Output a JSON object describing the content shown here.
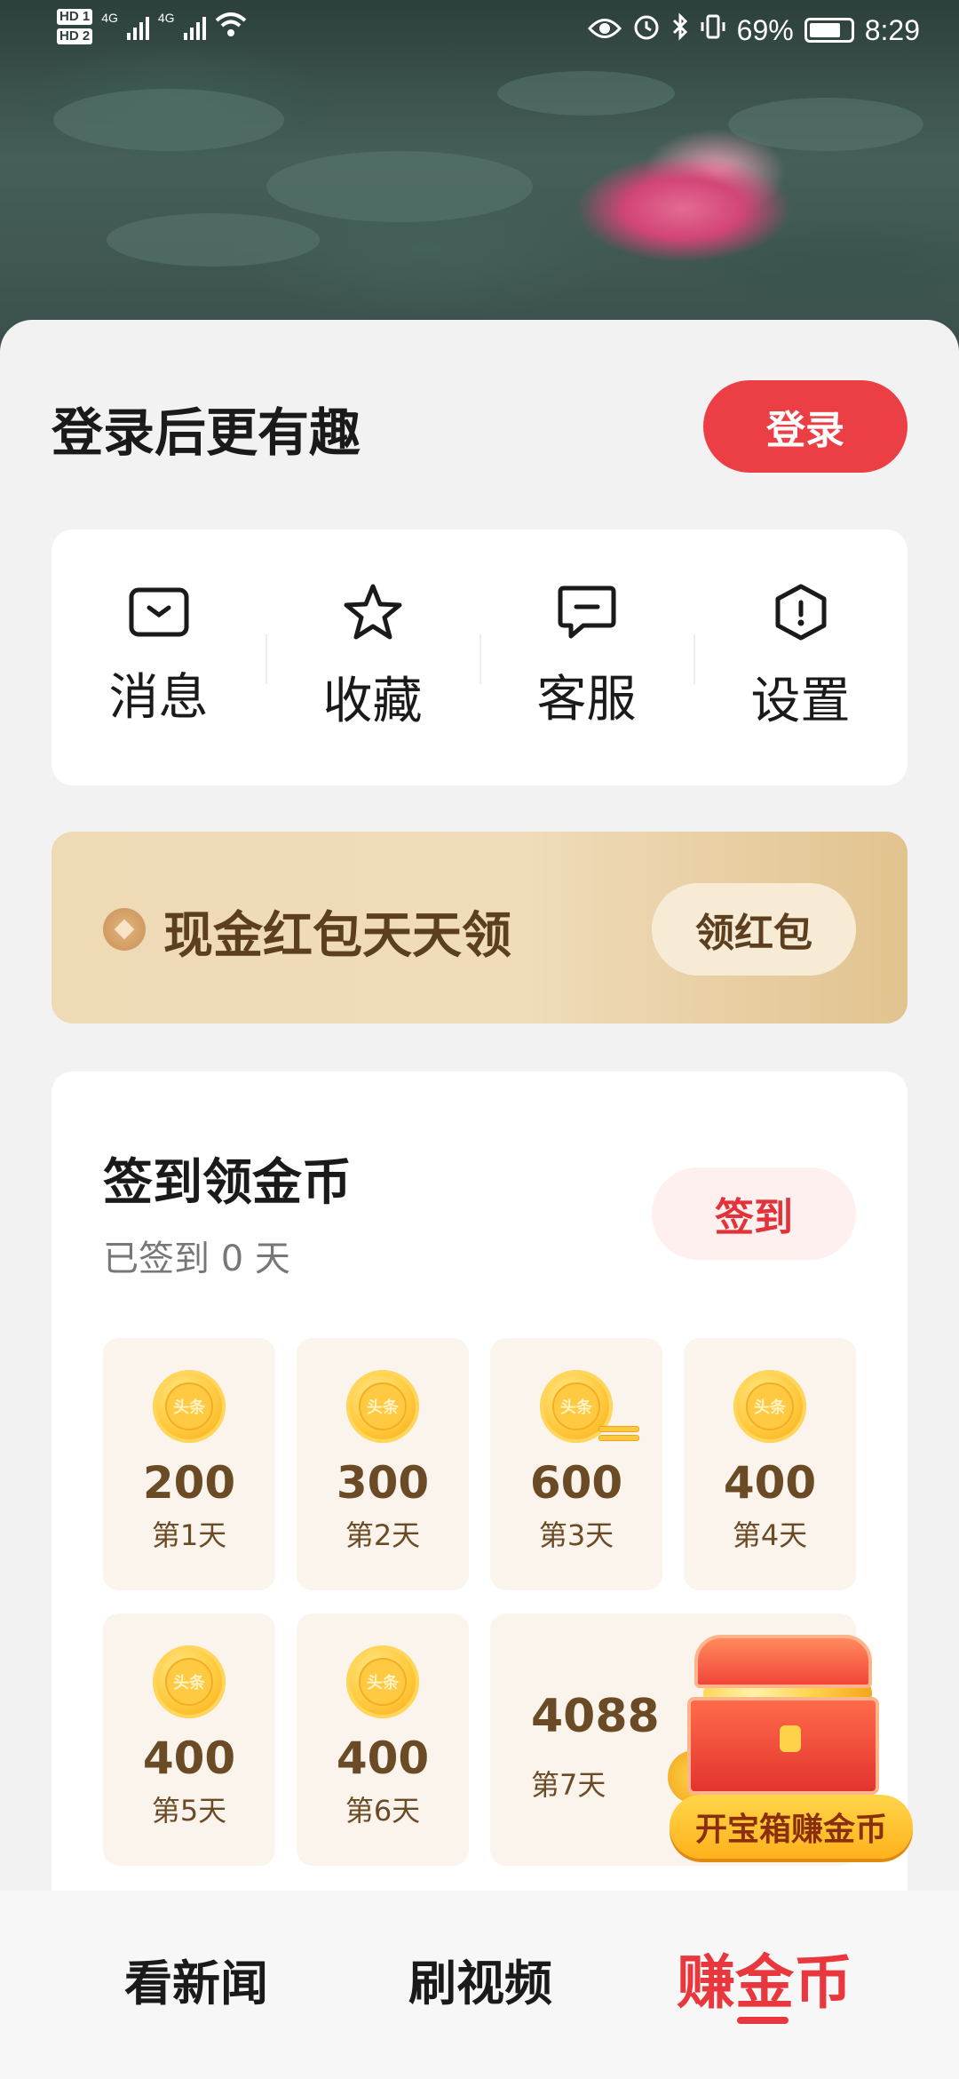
{
  "status_bar": {
    "hd1": "HD 1",
    "hd2": "HD 2",
    "net1": "4G",
    "net2": "4G",
    "battery": "69%",
    "time": "8:29"
  },
  "login": {
    "title": "登录后更有趣",
    "button": "登录"
  },
  "menu": {
    "items": [
      {
        "label": "消息",
        "icon": "message-icon"
      },
      {
        "label": "收藏",
        "icon": "star-icon"
      },
      {
        "label": "客服",
        "icon": "customer-service-icon"
      },
      {
        "label": "设置",
        "icon": "settings-icon"
      }
    ]
  },
  "red_packet": {
    "title": "现金红包天天领",
    "button": "领红包"
  },
  "checkin": {
    "title": "签到领金币",
    "subtitle": "已签到 0 天",
    "button": "签到",
    "coin_text": "头条",
    "days": [
      {
        "amount": "200",
        "label": "第1天"
      },
      {
        "amount": "300",
        "label": "第2天"
      },
      {
        "amount": "600",
        "label": "第3天"
      },
      {
        "amount": "400",
        "label": "第4天"
      },
      {
        "amount": "400",
        "label": "第5天"
      },
      {
        "amount": "400",
        "label": "第6天"
      },
      {
        "amount": "4088",
        "label": "第7天"
      }
    ]
  },
  "treasure": {
    "label": "开宝箱赚金币"
  },
  "bottom_nav": {
    "items": [
      {
        "label": "看新闻"
      },
      {
        "label": "刷视频"
      },
      {
        "label": "赚金币"
      }
    ],
    "active_index": 2
  },
  "colors": {
    "accent": "#e8373d",
    "gold_text": "#6b4a26",
    "redpack_bg": "#efdab6"
  }
}
